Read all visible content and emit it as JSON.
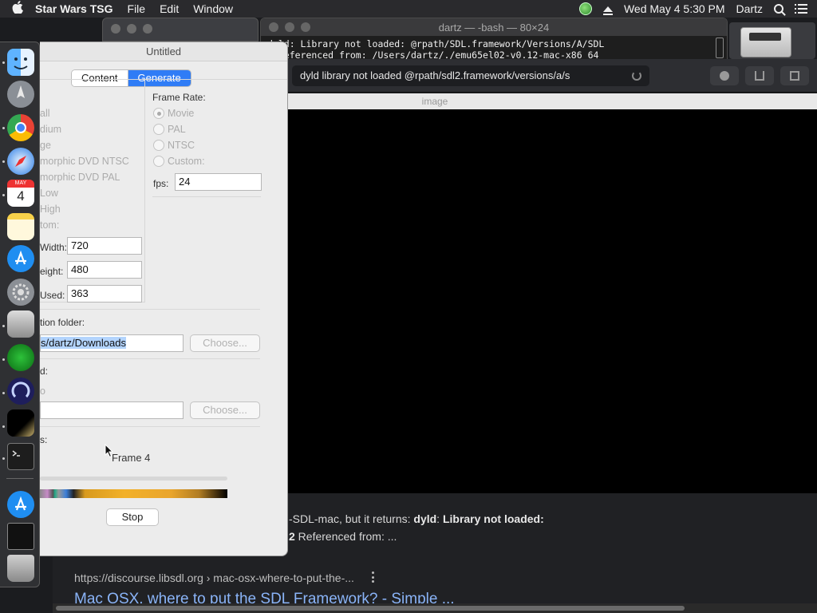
{
  "menubar": {
    "app_name": "Star Wars TSG",
    "menus": [
      "File",
      "Edit",
      "Window"
    ],
    "clock": "Wed May 4  5:30 PM",
    "user": "Dartz"
  },
  "terminal": {
    "title": "dartz — -bash — 80×24",
    "lines": [
      "dyld: Library not loaded: @rpath/SDL.framework/Versions/A/SDL",
      "  Referenced from: /Users/dartz/./emu65el02-v0.12-mac-x86_64"
    ]
  },
  "browser": {
    "url": "dyld library not loaded @rpath/sdl2.framework/versions/a/s",
    "tab_title": "image",
    "snippet_1_pre": "-SDL-mac, but it returns: ",
    "snippet_1_b1": "dyld",
    "snippet_1_mid": ": ",
    "snippet_1_b2": "Library not loaded:",
    "snippet_2_b": "2",
    "snippet_2_post": " Referenced from: ...",
    "cite": "https://discourse.libsdl.org › mac-osx-where-to-put-the-...",
    "result_title": "Mac OSX, where to put the SDL Framework? - Simple ..."
  },
  "dock": {
    "calendar_month": "MAY",
    "calendar_day": "4"
  },
  "untitled": {
    "title": "Untitled",
    "tabs": [
      "Content",
      "Generate"
    ],
    "active_tab": "Generate",
    "size_options": [
      "all",
      "dium",
      "ge",
      "morphic DVD NTSC",
      "morphic DVD PAL",
      "Low",
      "High",
      "tom:"
    ],
    "frame_rate_label": "Frame Rate:",
    "frame_rate_options": [
      "Movie",
      "PAL",
      "NTSC",
      "Custom:"
    ],
    "frame_rate_selected": "Movie",
    "fps_label": "fps:",
    "fps_value": "24",
    "width_label": "Width:",
    "width_value": "720",
    "height_label": "eight:",
    "height_value": "480",
    "used_label": "Used:",
    "used_value": "363",
    "dest_label": "tion folder:",
    "dest_value": "s/dartz/Downloads",
    "choose_label": "Choose...",
    "second_label": "d:",
    "second_sub": "o",
    "progress_label": "s:",
    "frame_status": "Frame 4",
    "progress_value": 0.0,
    "stop_label": "Stop"
  }
}
